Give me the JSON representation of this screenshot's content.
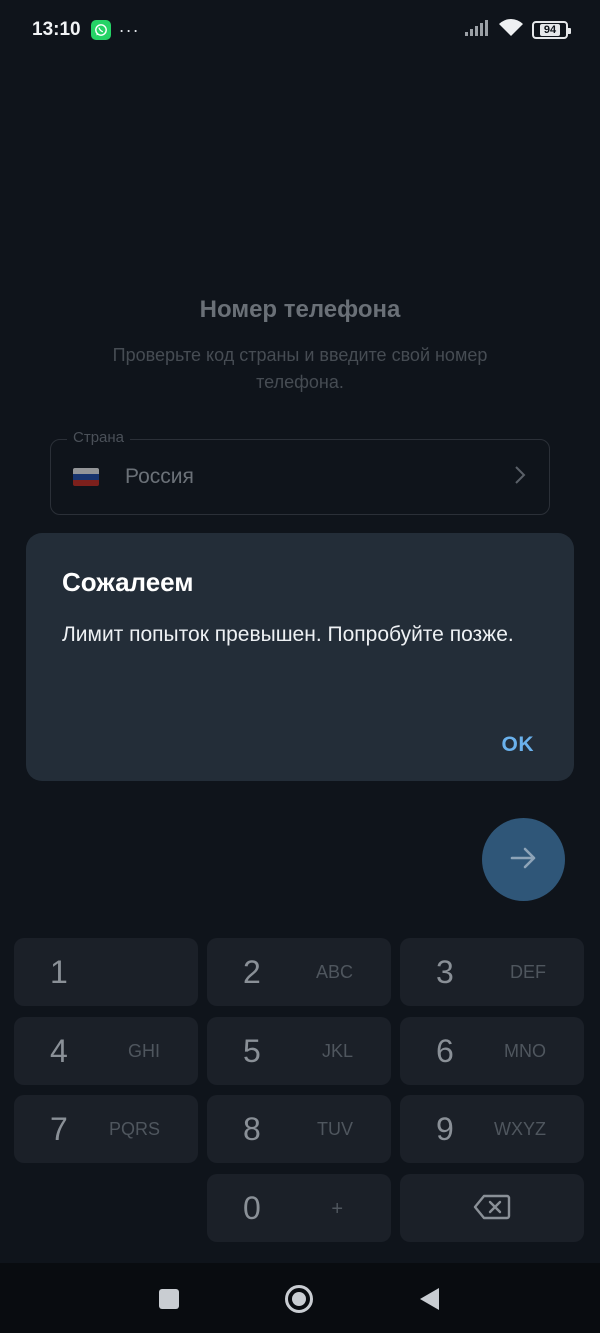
{
  "status_bar": {
    "time": "13:10",
    "dots": "···",
    "battery": "94",
    "icons": [
      "whatsapp-icon",
      "signal-icon",
      "wifi-icon",
      "battery-icon"
    ]
  },
  "screen": {
    "title": "Номер телефона",
    "subtitle": "Проверьте код страны и введите свой номер телефона."
  },
  "country": {
    "label": "Страна",
    "value": "Россия"
  },
  "dialog": {
    "title": "Сожалеем",
    "message": "Лимит попыток превышен. Попробуйте позже.",
    "ok_label": "OK"
  },
  "keypad": {
    "keys": [
      {
        "digit": "1",
        "letters": ""
      },
      {
        "digit": "2",
        "letters": "ABC"
      },
      {
        "digit": "3",
        "letters": "DEF"
      },
      {
        "digit": "4",
        "letters": "GHI"
      },
      {
        "digit": "5",
        "letters": "JKL"
      },
      {
        "digit": "6",
        "letters": "MNO"
      },
      {
        "digit": "7",
        "letters": "PQRS"
      },
      {
        "digit": "8",
        "letters": "TUV"
      },
      {
        "digit": "9",
        "letters": "WXYZ"
      },
      {
        "digit": "0",
        "letters": "+"
      }
    ]
  },
  "colors": {
    "background": "#0f141b",
    "dialog": "#232d38",
    "accent": "#6ab1ec",
    "fab": "#2f5678"
  }
}
